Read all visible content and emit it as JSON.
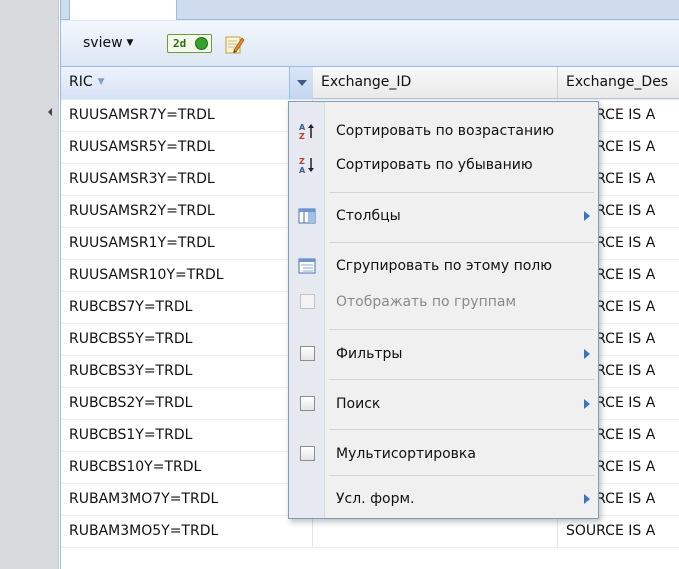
{
  "toolbar": {
    "view_label": "sview",
    "toggle_2d_label": "2d"
  },
  "grid": {
    "columns": [
      "RIC",
      "Exchange_ID",
      "Exchange_Des"
    ],
    "rows": [
      {
        "ric": "RUUSAMSR7Y=TRDL",
        "exchange_id": "",
        "exchange_desc": "SOURCE IS A"
      },
      {
        "ric": "RUUSAMSR5Y=TRDL",
        "exchange_id": "",
        "exchange_desc": "SOURCE IS A"
      },
      {
        "ric": "RUUSAMSR3Y=TRDL",
        "exchange_id": "",
        "exchange_desc": "SOURCE IS A"
      },
      {
        "ric": "RUUSAMSR2Y=TRDL",
        "exchange_id": "",
        "exchange_desc": "SOURCE IS A"
      },
      {
        "ric": "RUUSAMSR1Y=TRDL",
        "exchange_id": "",
        "exchange_desc": "SOURCE IS A"
      },
      {
        "ric": "RUUSAMSR10Y=TRDL",
        "exchange_id": "",
        "exchange_desc": "SOURCE IS A"
      },
      {
        "ric": "RUBCBS7Y=TRDL",
        "exchange_id": "",
        "exchange_desc": "SOURCE IS A"
      },
      {
        "ric": "RUBCBS5Y=TRDL",
        "exchange_id": "",
        "exchange_desc": "SOURCE IS A"
      },
      {
        "ric": "RUBCBS3Y=TRDL",
        "exchange_id": "",
        "exchange_desc": "SOURCE IS A"
      },
      {
        "ric": "RUBCBS2Y=TRDL",
        "exchange_id": "",
        "exchange_desc": "SOURCE IS A"
      },
      {
        "ric": "RUBCBS1Y=TRDL",
        "exchange_id": "",
        "exchange_desc": "SOURCE IS A"
      },
      {
        "ric": "RUBCBS10Y=TRDL",
        "exchange_id": "",
        "exchange_desc": "SOURCE IS A"
      },
      {
        "ric": "RUBAM3MO7Y=TRDL",
        "exchange_id": "",
        "exchange_desc": "SOURCE IS A"
      },
      {
        "ric": "RUBAM3MO5Y=TRDL",
        "exchange_id": "",
        "exchange_desc": "SOURCE IS A"
      }
    ]
  },
  "menu": {
    "items": [
      {
        "label": "Сортировать по возрастанию",
        "icon": "sort-ascending-icon",
        "submenu": false,
        "disabled": false
      },
      {
        "label": "Сортировать по убыванию",
        "icon": "sort-descending-icon",
        "submenu": false,
        "disabled": false
      },
      {
        "label": "Столбцы",
        "icon": "columns-icon",
        "submenu": true,
        "disabled": false
      },
      {
        "label": "Сгрупировать по этому полю",
        "icon": "group-by-icon",
        "submenu": false,
        "disabled": false
      },
      {
        "label": "Отображать по группам",
        "icon": "checkbox-icon",
        "submenu": false,
        "disabled": true
      },
      {
        "label": "Фильтры",
        "icon": "checkbox-icon",
        "submenu": true,
        "disabled": false
      },
      {
        "label": "Поиск",
        "icon": "checkbox-icon",
        "submenu": true,
        "disabled": false
      },
      {
        "label": "Мультисортировка",
        "icon": "checkbox-icon",
        "submenu": false,
        "disabled": false
      },
      {
        "label": "Усл. форм.",
        "icon": "",
        "submenu": true,
        "disabled": false
      }
    ]
  },
  "colors": {
    "header_border": "#99bbe8",
    "submenu_arrow": "#3b73c4",
    "toggle_on": "#33a12c"
  }
}
